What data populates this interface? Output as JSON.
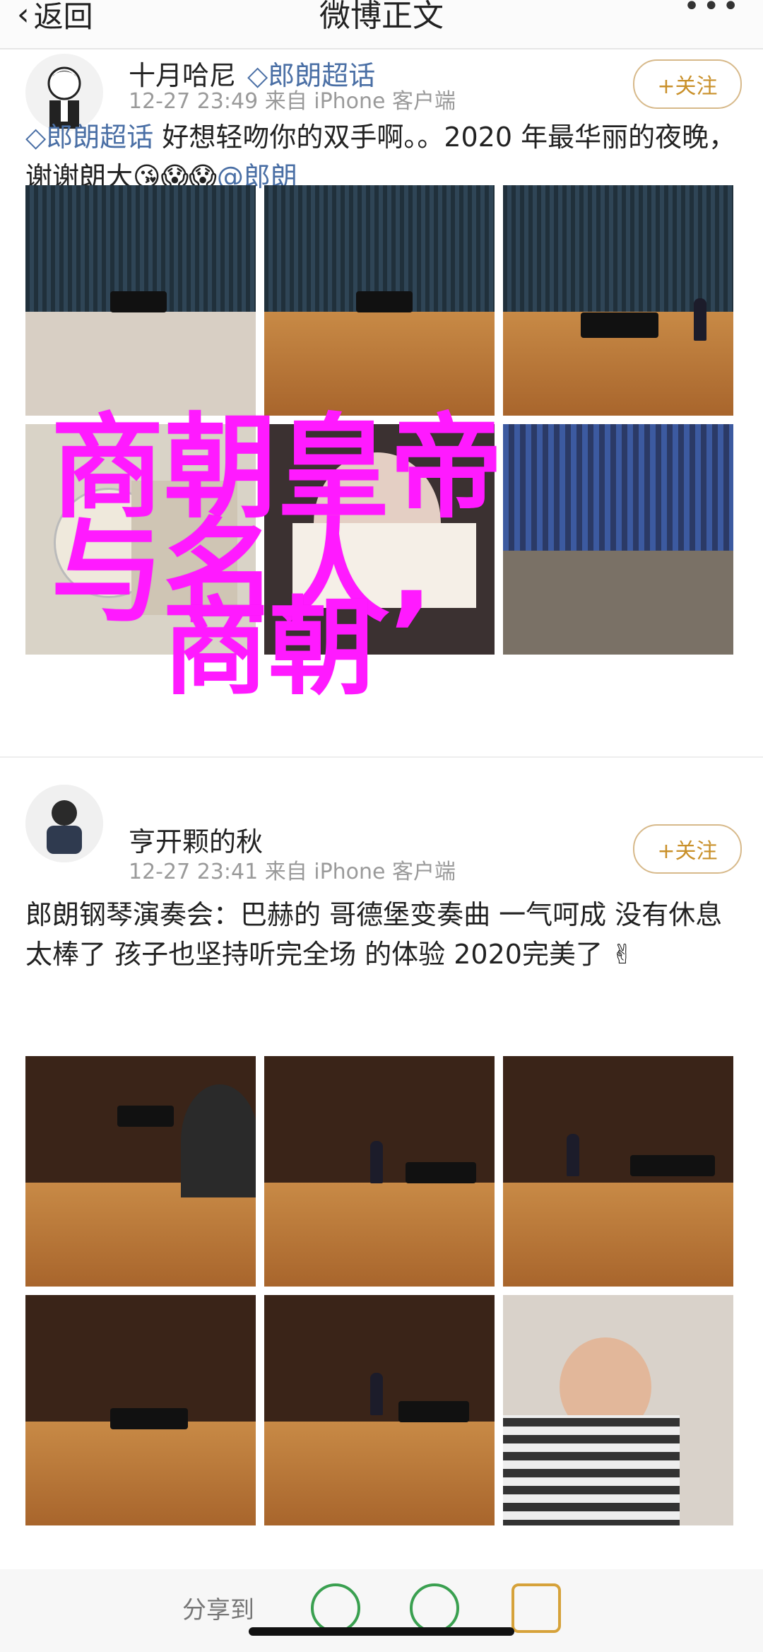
{
  "header": {
    "back_label": "返回",
    "title": "微博正文",
    "more": "•••"
  },
  "post1": {
    "username": "十月哈尼",
    "topic_tag": "郎朗超话",
    "meta": "12-27 23:49  来自 iPhone 客户端",
    "follow_label": "+关注",
    "text_topic": "郎朗超话",
    "text_body": " 好想轻吻你的双手啊。。2020 年最华丽的夜晚，谢谢朗大",
    "emoji": "😘😱😱",
    "mention": "@郎朗"
  },
  "post2": {
    "username": "亨开颗的秋",
    "meta": "12-27 23:41  来自 iPhone 客户端",
    "follow_label": "+关注",
    "text_body": "郎朗钢琴演奏会：巴赫的 哥德堡变奏曲 一气呵成 没有休息 太棒了 孩子也坚持听完全场 的体验 2020完美了",
    "emoji": "✌"
  },
  "overlay": {
    "line1": "商朝皇帝",
    "line2": "与名人,",
    "line3": "商朝"
  },
  "share": {
    "label": "分享到"
  },
  "colors": {
    "overlay": "#ff1aff",
    "link": "#4a6fa5",
    "follow_border": "#d7b98a"
  }
}
